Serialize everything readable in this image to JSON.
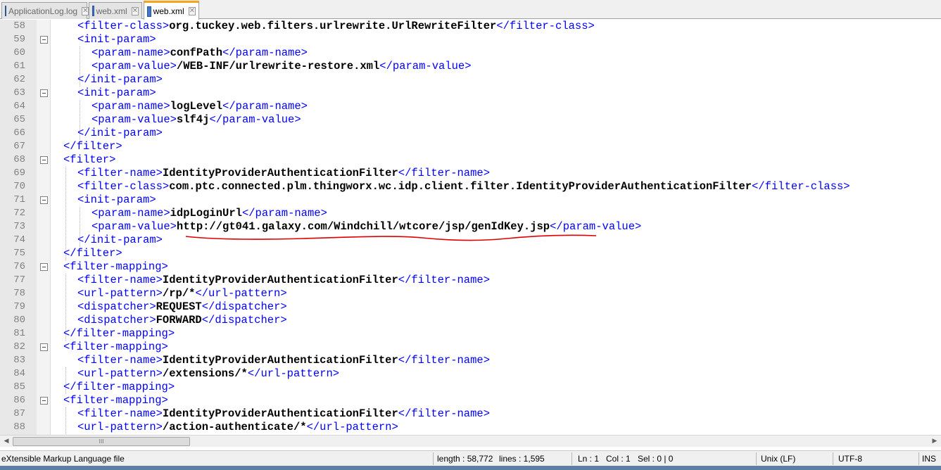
{
  "tabs": [
    {
      "label": "ApplicationLog.log",
      "active": false
    },
    {
      "label": "web.xml",
      "active": false
    },
    {
      "label": "web.xml",
      "active": true
    }
  ],
  "editor": {
    "lines": [
      {
        "num": "58",
        "indent": 2,
        "fold": false,
        "seg": [
          {
            "t": "<filter-class>"
          },
          {
            "x": "org.tuckey.web.filters.urlrewrite.UrlRewriteFilter"
          },
          {
            "t": "</filter-class>"
          }
        ]
      },
      {
        "num": "59",
        "indent": 2,
        "fold": true,
        "seg": [
          {
            "t": "<init-param>"
          }
        ]
      },
      {
        "num": "60",
        "indent": 3,
        "fold": false,
        "seg": [
          {
            "t": "<param-name>"
          },
          {
            "x": "confPath"
          },
          {
            "t": "</param-name>"
          }
        ]
      },
      {
        "num": "61",
        "indent": 3,
        "fold": false,
        "seg": [
          {
            "t": "<param-value>"
          },
          {
            "x": "/WEB-INF/urlrewrite-restore.xml"
          },
          {
            "t": "</param-value>"
          }
        ]
      },
      {
        "num": "62",
        "indent": 2,
        "fold": false,
        "seg": [
          {
            "t": "</init-param>"
          }
        ]
      },
      {
        "num": "63",
        "indent": 2,
        "fold": true,
        "seg": [
          {
            "t": "<init-param>"
          }
        ]
      },
      {
        "num": "64",
        "indent": 3,
        "fold": false,
        "seg": [
          {
            "t": "<param-name>"
          },
          {
            "x": "logLevel"
          },
          {
            "t": "</param-name>"
          }
        ]
      },
      {
        "num": "65",
        "indent": 3,
        "fold": false,
        "seg": [
          {
            "t": "<param-value>"
          },
          {
            "x": "slf4j"
          },
          {
            "t": "</param-value>"
          }
        ]
      },
      {
        "num": "66",
        "indent": 2,
        "fold": false,
        "seg": [
          {
            "t": "</init-param>"
          }
        ]
      },
      {
        "num": "67",
        "indent": 1,
        "fold": false,
        "seg": [
          {
            "t": "</filter>"
          }
        ]
      },
      {
        "num": "68",
        "indent": 1,
        "fold": true,
        "seg": [
          {
            "t": "<filter>"
          }
        ]
      },
      {
        "num": "69",
        "indent": 2,
        "fold": false,
        "seg": [
          {
            "t": "<filter-name>"
          },
          {
            "x": "IdentityProviderAuthenticationFilter"
          },
          {
            "t": "</filter-name>"
          }
        ]
      },
      {
        "num": "70",
        "indent": 2,
        "fold": false,
        "seg": [
          {
            "t": "<filter-class>"
          },
          {
            "x": "com.ptc.connected.plm.thingworx.wc.idp.client.filter.IdentityProviderAuthenticationFilter"
          },
          {
            "t": "</filter-class>"
          }
        ]
      },
      {
        "num": "71",
        "indent": 2,
        "fold": true,
        "seg": [
          {
            "t": "<init-param>"
          }
        ]
      },
      {
        "num": "72",
        "indent": 3,
        "fold": false,
        "seg": [
          {
            "t": "<param-name>"
          },
          {
            "x": "idpLoginUrl"
          },
          {
            "t": "</param-name>"
          }
        ]
      },
      {
        "num": "73",
        "indent": 3,
        "fold": false,
        "seg": [
          {
            "t": "<param-value>"
          },
          {
            "x": "http://gt041.galaxy.com/Windchill/wtcore/jsp/genIdKey.jsp"
          },
          {
            "t": "</param-value>"
          }
        ]
      },
      {
        "num": "74",
        "indent": 2,
        "fold": false,
        "seg": [
          {
            "t": "</init-param>"
          }
        ]
      },
      {
        "num": "75",
        "indent": 1,
        "fold": false,
        "seg": [
          {
            "t": "</filter>"
          }
        ]
      },
      {
        "num": "76",
        "indent": 1,
        "fold": true,
        "seg": [
          {
            "t": "<filter-mapping>"
          }
        ]
      },
      {
        "num": "77",
        "indent": 2,
        "fold": false,
        "seg": [
          {
            "t": "<filter-name>"
          },
          {
            "x": "IdentityProviderAuthenticationFilter"
          },
          {
            "t": "</filter-name>"
          }
        ]
      },
      {
        "num": "78",
        "indent": 2,
        "fold": false,
        "seg": [
          {
            "t": "<url-pattern>"
          },
          {
            "x": "/rp/*"
          },
          {
            "t": "</url-pattern>"
          }
        ]
      },
      {
        "num": "79",
        "indent": 2,
        "fold": false,
        "seg": [
          {
            "t": "<dispatcher>"
          },
          {
            "x": "REQUEST"
          },
          {
            "t": "</dispatcher>"
          }
        ]
      },
      {
        "num": "80",
        "indent": 2,
        "fold": false,
        "seg": [
          {
            "t": "<dispatcher>"
          },
          {
            "x": "FORWARD"
          },
          {
            "t": "</dispatcher>"
          }
        ]
      },
      {
        "num": "81",
        "indent": 1,
        "fold": false,
        "seg": [
          {
            "t": "</filter-mapping>"
          }
        ]
      },
      {
        "num": "82",
        "indent": 1,
        "fold": true,
        "seg": [
          {
            "t": "<filter-mapping>"
          }
        ]
      },
      {
        "num": "83",
        "indent": 2,
        "fold": false,
        "seg": [
          {
            "t": "<filter-name>"
          },
          {
            "x": "IdentityProviderAuthenticationFilter"
          },
          {
            "t": "</filter-name>"
          }
        ]
      },
      {
        "num": "84",
        "indent": 2,
        "fold": false,
        "seg": [
          {
            "t": "<url-pattern>"
          },
          {
            "x": "/extensions/*"
          },
          {
            "t": "</url-pattern>"
          }
        ]
      },
      {
        "num": "85",
        "indent": 1,
        "fold": false,
        "seg": [
          {
            "t": "</filter-mapping>"
          }
        ]
      },
      {
        "num": "86",
        "indent": 1,
        "fold": true,
        "seg": [
          {
            "t": "<filter-mapping>"
          }
        ]
      },
      {
        "num": "87",
        "indent": 2,
        "fold": false,
        "seg": [
          {
            "t": "<filter-name>"
          },
          {
            "x": "IdentityProviderAuthenticationFilter"
          },
          {
            "t": "</filter-name>"
          }
        ]
      },
      {
        "num": "88",
        "indent": 2,
        "fold": false,
        "seg": [
          {
            "t": "<url-pattern>"
          },
          {
            "x": "/action-authenticate/*"
          },
          {
            "t": "</url-pattern>"
          }
        ]
      }
    ],
    "annotation_color": "#e00000",
    "tag_color": "#0000ff"
  },
  "scrollbar": {
    "left_icon": "arrow-left-icon",
    "right_icon": "arrow-right-icon",
    "thumb_grip": "III"
  },
  "statusbar": {
    "file_type": "eXtensible Markup Language file",
    "length": "length : 58,772",
    "lines": "lines : 1,595",
    "ln": "Ln : 1",
    "col": "Col : 1",
    "sel": "Sel : 0 | 0",
    "eol": "Unix (LF)",
    "encoding": "UTF-8",
    "mode": "INS"
  }
}
